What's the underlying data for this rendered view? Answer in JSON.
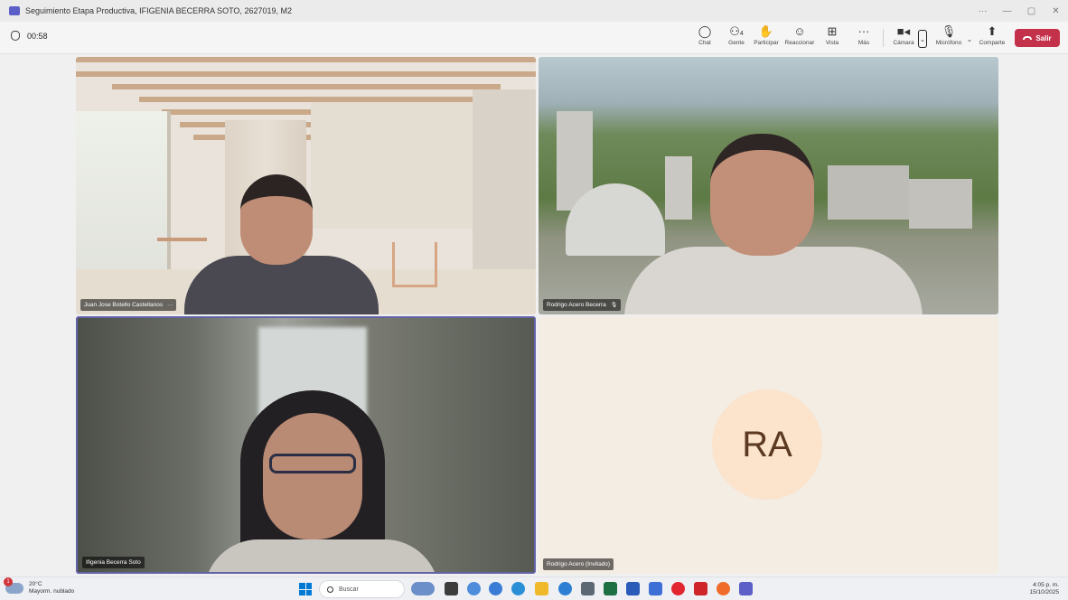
{
  "window": {
    "title": "Seguimiento Etapa Productiva, IFIGENIA BECERRA SOTO, 2627019, M2",
    "controls": [
      "···",
      "—",
      "▢",
      "✕"
    ]
  },
  "meeting": {
    "timer": "00:58",
    "toolbar": {
      "chat": "Chat",
      "people": "Gente",
      "people_count": "4",
      "raise": "Participar",
      "react": "Reaccionar",
      "view": "Vista",
      "more": "Más",
      "camera": "Cámara",
      "mic": "Micrófono",
      "share": "Comparte",
      "leave": "Salir"
    }
  },
  "participants": [
    {
      "name": "Juan Jose Botello Castellanos",
      "extra": "···"
    },
    {
      "name": "Rodrigo Acero Becerra",
      "extra": "🎙"
    },
    {
      "name": "Ifigenia Becerra Soto"
    },
    {
      "name": "Rodrigo Acero (Invitado)",
      "initials": "RA"
    }
  ],
  "taskbar": {
    "weather_temp": "20°C",
    "weather_desc": "Mayorm. nublado",
    "weather_badge": "1",
    "search_placeholder": "Buscar",
    "time": "4:05 p. m.",
    "date": "15/10/2025"
  }
}
